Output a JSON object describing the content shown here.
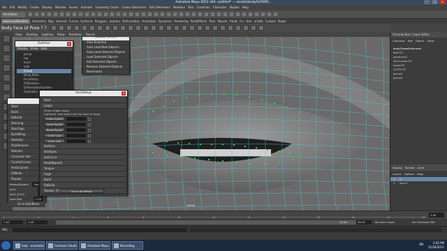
{
  "window": {
    "title": "Autodesk Maya 2012 x64: untitled* --- modelcbodyA[3569]..."
  },
  "menubar": [
    "File",
    "Edit",
    "Modify",
    "Create",
    "Display",
    "Window",
    "Assets",
    "Animate",
    "Geometry Cache",
    "Create Deformers",
    "Edit Deformers",
    "Skeleton",
    "Skin",
    "Constrain",
    "Character",
    "Skybox",
    "Help"
  ],
  "statusline": {
    "mode": "Animation"
  },
  "shelf_tabs": [
    "advancedSkeleton",
    "Animation",
    "Bigi",
    "General",
    "Curves",
    "Surfaces",
    "Polygons",
    "Subdivs",
    "Deformation",
    "Animation",
    "Dynamics",
    "Rendering",
    "PaintEffects",
    "Toon",
    "Muscle",
    "Fluids",
    "Fur",
    "Hair",
    "nCloth",
    "Custom",
    "Power"
  ],
  "shelf": {
    "label": "Body Face  UI  Pose  ?  ?"
  },
  "viewport_menu": [
    "View",
    "Shading",
    "Lighting",
    "Show",
    "Renderer",
    "Panels"
  ],
  "outliner": {
    "title": "Outliner",
    "menu": [
      "Display",
      "Show",
      "Help"
    ],
    "items": [
      "persp",
      "top",
      "front",
      "side",
      "Group",
      "Brow_Main",
      "FaceSetup",
      "FitSkeleton",
      "DeformationSystem",
      "Geometry"
    ],
    "highlight_index": 4
  },
  "isolate": {
    "title": "Isolate Select",
    "items": [
      "View Selected",
      "Auto Load New Objects",
      "Auto Load Selected Objects",
      "Load Selected Objects",
      "Add Selected Objects",
      "Remove Selected Objects",
      "Bookmarks"
    ]
  },
  "bigmenu": {
    "items": [
      "Start",
      "Build",
      "ReBuild",
      "Skinning",
      "SkinCage",
      "BuildWrap",
      "Skeleton",
      "PolyRemove",
      "Selector",
      "Character Set",
      "ControlCurves",
      "Partial Joints",
      "FitMode",
      "Display"
    ],
    "fields": [
      {
        "label": "MotionSystem",
        "value": "None"
      },
      {
        "label": "Joint",
        "value": "1"
      },
      {
        "label": "Joint (2/14)",
        "value": "1"
      },
      {
        "label": "Joint Size",
        "value": "1.00"
      }
    ],
    "bottom_button": "Go to BuildPose"
  },
  "facesetup": {
    "title": "faceSetup",
    "sections_top": [
      "Start",
      "Loops"
    ],
    "note1": "Select Edges loops",
    "note2": "(optional: also select vert for start of loop)",
    "buttons": [
      "Outer Eyelid",
      "Inner Eyelid",
      "Brow Eyelid",
      "Outer Lips",
      "Inner Lips"
    ],
    "sections_bottom": [
      "Vertices",
      "SkinEyes",
      "JawCurve",
      "HeadNaponX",
      "Tongue",
      "Cage",
      "Build",
      "ReBuild",
      "Tweaks: fcf.db8"
    ],
    "bottom_button": "Go to BuildPose"
  },
  "rightpanel": {
    "header": "Channel Box / Layer Editor",
    "tabs": [
      "Channels",
      "Edit",
      "Object",
      "Show"
    ],
    "rows": [
      "bodyShapeDeformed",
      "INPUTS",
      "polySmth1",
      "skinCluster18",
      "tweak35",
      "OUTPUTS",
      "group3",
      "group2"
    ],
    "layer_tabs": [
      "Display",
      "Render",
      "Anim"
    ],
    "layer_menu": [
      "Layers",
      "Options",
      "Help"
    ],
    "layers": [
      {
        "v": "V",
        "name": "ui",
        "selected": true
      },
      {
        "v": "V",
        "name": "layer1",
        "selected": false
      }
    ]
  },
  "timeslider": {
    "ticks": [
      "1",
      "2",
      "4",
      "6",
      "8",
      "10",
      "12",
      "14",
      "16",
      "18",
      "20",
      "22",
      "24"
    ],
    "end": "1.00"
  },
  "rangeslider": {
    "start": "1.00",
    "start2": "1.00",
    "end1": "24.00",
    "end2": "48.00",
    "anim_layer": "No Anim Layer",
    "char_set": "No Character Set"
  },
  "cmdline": {
    "label": "MEL"
  },
  "helpline": "",
  "taskbar": {
    "tasks": [
      "help - anumation...",
      "Camtasia Studio -",
      "Autodesk Maya 2...",
      "Recording..."
    ],
    "lang": "EN",
    "time": "2:02 PM",
    "date": "11/26/2011"
  },
  "colors": {
    "wire": "#4fc7d4",
    "vert": "#22dd44",
    "bg": "#444444",
    "title_bar": "#3a4a5c"
  }
}
